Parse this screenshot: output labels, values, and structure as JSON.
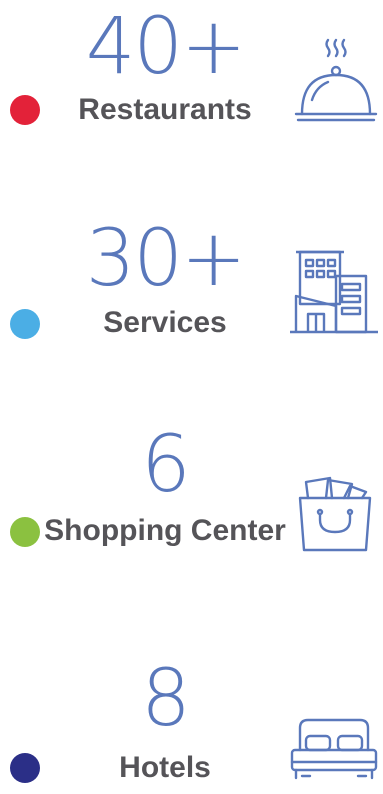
{
  "stats": [
    {
      "number": "40+",
      "label": "Restaurants",
      "icon": "cloche-icon",
      "dot_color": "#e32239"
    },
    {
      "number": "30+",
      "label": "Services",
      "icon": "building-icon",
      "dot_color": "#4baee5"
    },
    {
      "number": "6",
      "label": "Shopping Center",
      "icon": "shopping-bag-icon",
      "dot_color": "#8bc140"
    },
    {
      "number": "8",
      "label": "Hotels",
      "icon": "bed-icon",
      "dot_color": "#2b2f87"
    }
  ],
  "colors": {
    "accent": "#5a78bb",
    "label_text": "#555458",
    "background": "#ffffff"
  }
}
